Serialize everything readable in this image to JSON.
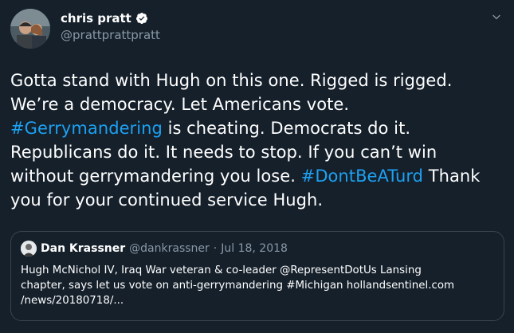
{
  "tweet": {
    "display_name": "chris pratt",
    "handle": "@prattprattpratt",
    "verified_icon": "verified-badge-icon",
    "menu_icon": "chevron-down-icon",
    "text": {
      "s1": "Gotta stand with Hugh on this one. Rigged is rigged.\nWe’re a democracy. Let Americans vote.\n",
      "tag1": "#Gerrymandering",
      "s2": " is cheating. Democrats do it.\nRepublicans do it. It needs to stop. If you can’t win\nwithout gerrymandering you lose. ",
      "tag2": "#DontBeATurd",
      "s3": " Thank\nyou for your continued service Hugh."
    }
  },
  "quoted_tweet": {
    "display_name": "Dan Krassner",
    "handle": "@dankrassner",
    "separator": " · ",
    "date": "Jul 18, 2018",
    "text": "Hugh McNichol IV, Iraq War veteran & co-leader @RepresentDotUs Lansing\nchapter, says let us vote on anti-gerrymandering #Michigan hollandsentinel.com\n/news/20180718/..."
  },
  "colors": {
    "background": "#15202b",
    "link": "#1da1f2",
    "secondary_text": "#8899a6",
    "border": "#38444d"
  }
}
